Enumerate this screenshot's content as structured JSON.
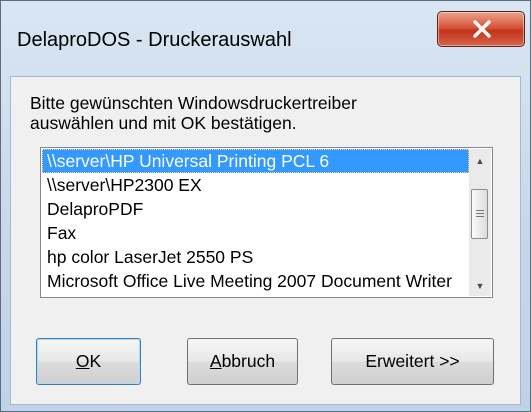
{
  "window": {
    "title": "DelaproDOS - Druckerauswahl"
  },
  "prompt": {
    "text": "Bitte gewünschten Windowsdruckertreiber\nauswählen und mit OK bestätigen."
  },
  "printer_list": {
    "items": [
      "\\\\server\\HP Universal Printing PCL 6",
      "\\\\server\\HP2300 EX",
      "DelaproPDF",
      "Fax",
      "hp color LaserJet 2550 PS",
      "Microsoft Office Live Meeting 2007 Document Writer"
    ],
    "selected_index": 0
  },
  "buttons": {
    "ok": {
      "mnemonic": "O",
      "rest": "K"
    },
    "abbruch": {
      "mnemonic": "A",
      "rest": "bbruch"
    },
    "erweitert": {
      "label": "Erweitert >>"
    }
  },
  "colors": {
    "selection": "#3399ff",
    "close_button": "#c2361d"
  }
}
